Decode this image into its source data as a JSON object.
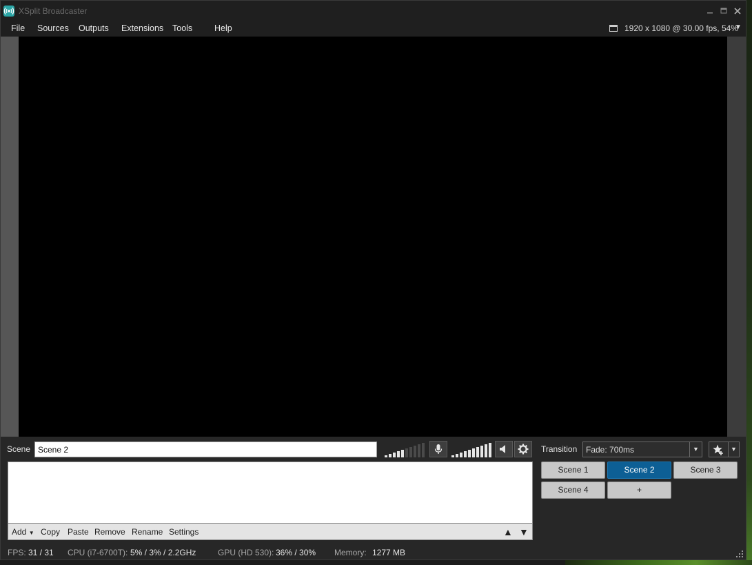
{
  "window": {
    "title": "XSplit Broadcaster"
  },
  "menu": {
    "items": [
      "File",
      "Sources",
      "Outputs",
      "Extensions",
      "Tools",
      "Help"
    ],
    "resolution": "1920 x 1080 @ 30.00 fps, 54%"
  },
  "scene": {
    "label": "Scene",
    "value": "Scene 2"
  },
  "transition": {
    "label": "Transition",
    "value": "Fade: 700ms"
  },
  "sources_toolbar": {
    "add": "Add",
    "copy": "Copy",
    "paste": "Paste",
    "remove": "Remove",
    "rename": "Rename",
    "settings": "Settings"
  },
  "scenes": [
    {
      "label": "Scene 1",
      "active": false
    },
    {
      "label": "Scene 2",
      "active": true
    },
    {
      "label": "Scene 3",
      "active": false
    },
    {
      "label": "Scene 4",
      "active": false
    },
    {
      "label": "+",
      "active": false
    }
  ],
  "status": {
    "fps_label": "FPS:",
    "fps_value": "31 / 31",
    "cpu_label": "CPU (i7-6700T):",
    "cpu_value": "5% / 3% / 2.2GHz",
    "gpu_label": "GPU (HD 530):",
    "gpu_value": "36% / 30%",
    "memory_label": "Memory:",
    "memory_value": "1277 MB"
  },
  "colors": {
    "accent": "#0d5f95",
    "app_icon": "#2aa6a6"
  }
}
